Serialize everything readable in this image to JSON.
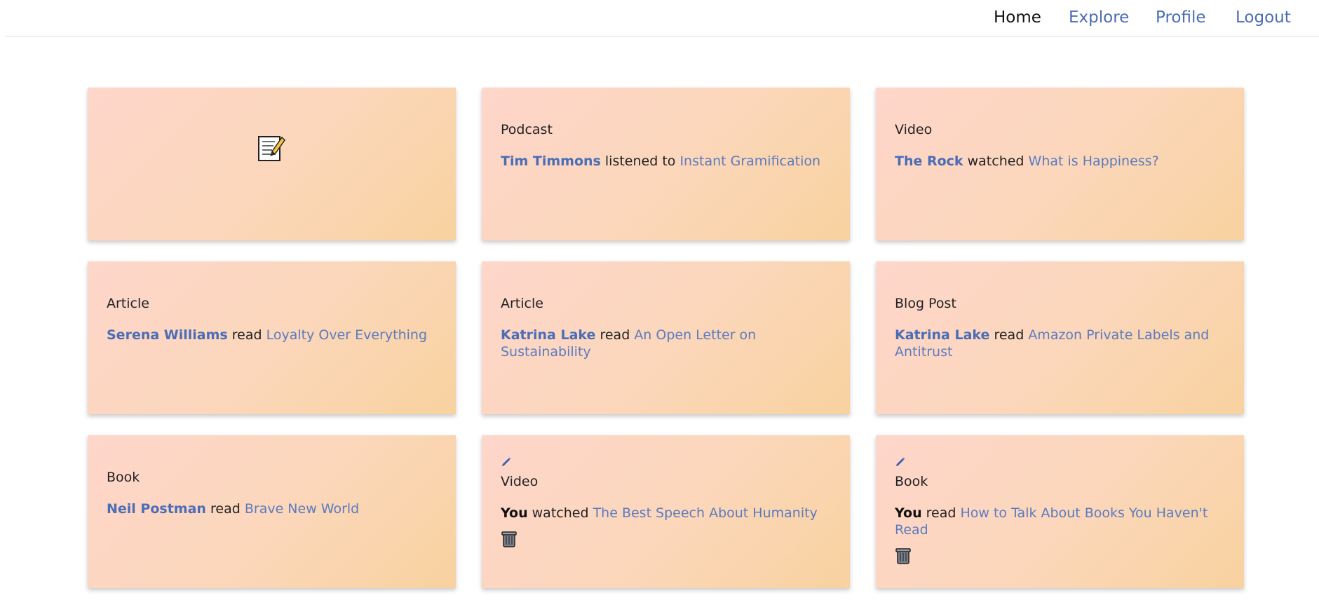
{
  "nav": {
    "home": "Home",
    "explore": "Explore",
    "profile": "Profile",
    "logout": "Logout"
  },
  "compose": {
    "icon": "memo-compose-icon"
  },
  "cards": [
    {
      "type": "Podcast",
      "actor": "Tim Timmons",
      "verb": "listened to",
      "title": "Instant Gramification"
    },
    {
      "type": "Video",
      "actor": "The Rock",
      "verb": "watched",
      "title": "What is Happiness?"
    },
    {
      "type": "Article",
      "actor": "Serena Williams",
      "verb": "read",
      "title": "Loyalty Over Everything"
    },
    {
      "type": "Article",
      "actor": "Katrina Lake",
      "verb": "read",
      "title": "An Open Letter on Sustainability"
    },
    {
      "type": "Blog Post",
      "actor": "Katrina Lake",
      "verb": "read",
      "title": "Amazon Private Labels and Antitrust"
    },
    {
      "type": "Book",
      "actor": "Neil Postman",
      "verb": "read",
      "title": "Brave New World"
    },
    {
      "type": "Video",
      "actor": "You",
      "verb": "watched",
      "title": "The Best Speech About Humanity",
      "editable": true
    },
    {
      "type": "Book",
      "actor": "You",
      "verb": "read",
      "title": "How to Talk About Books You Haven't Read",
      "editable": true
    }
  ],
  "icons": {
    "edit": "pencil-icon",
    "delete": "trash-icon"
  },
  "colors": {
    "link": "#4a6db5",
    "title_link": "#5b7bbf",
    "card_gradient_start": "#fed6cb",
    "card_gradient_end": "#f8d29f"
  }
}
